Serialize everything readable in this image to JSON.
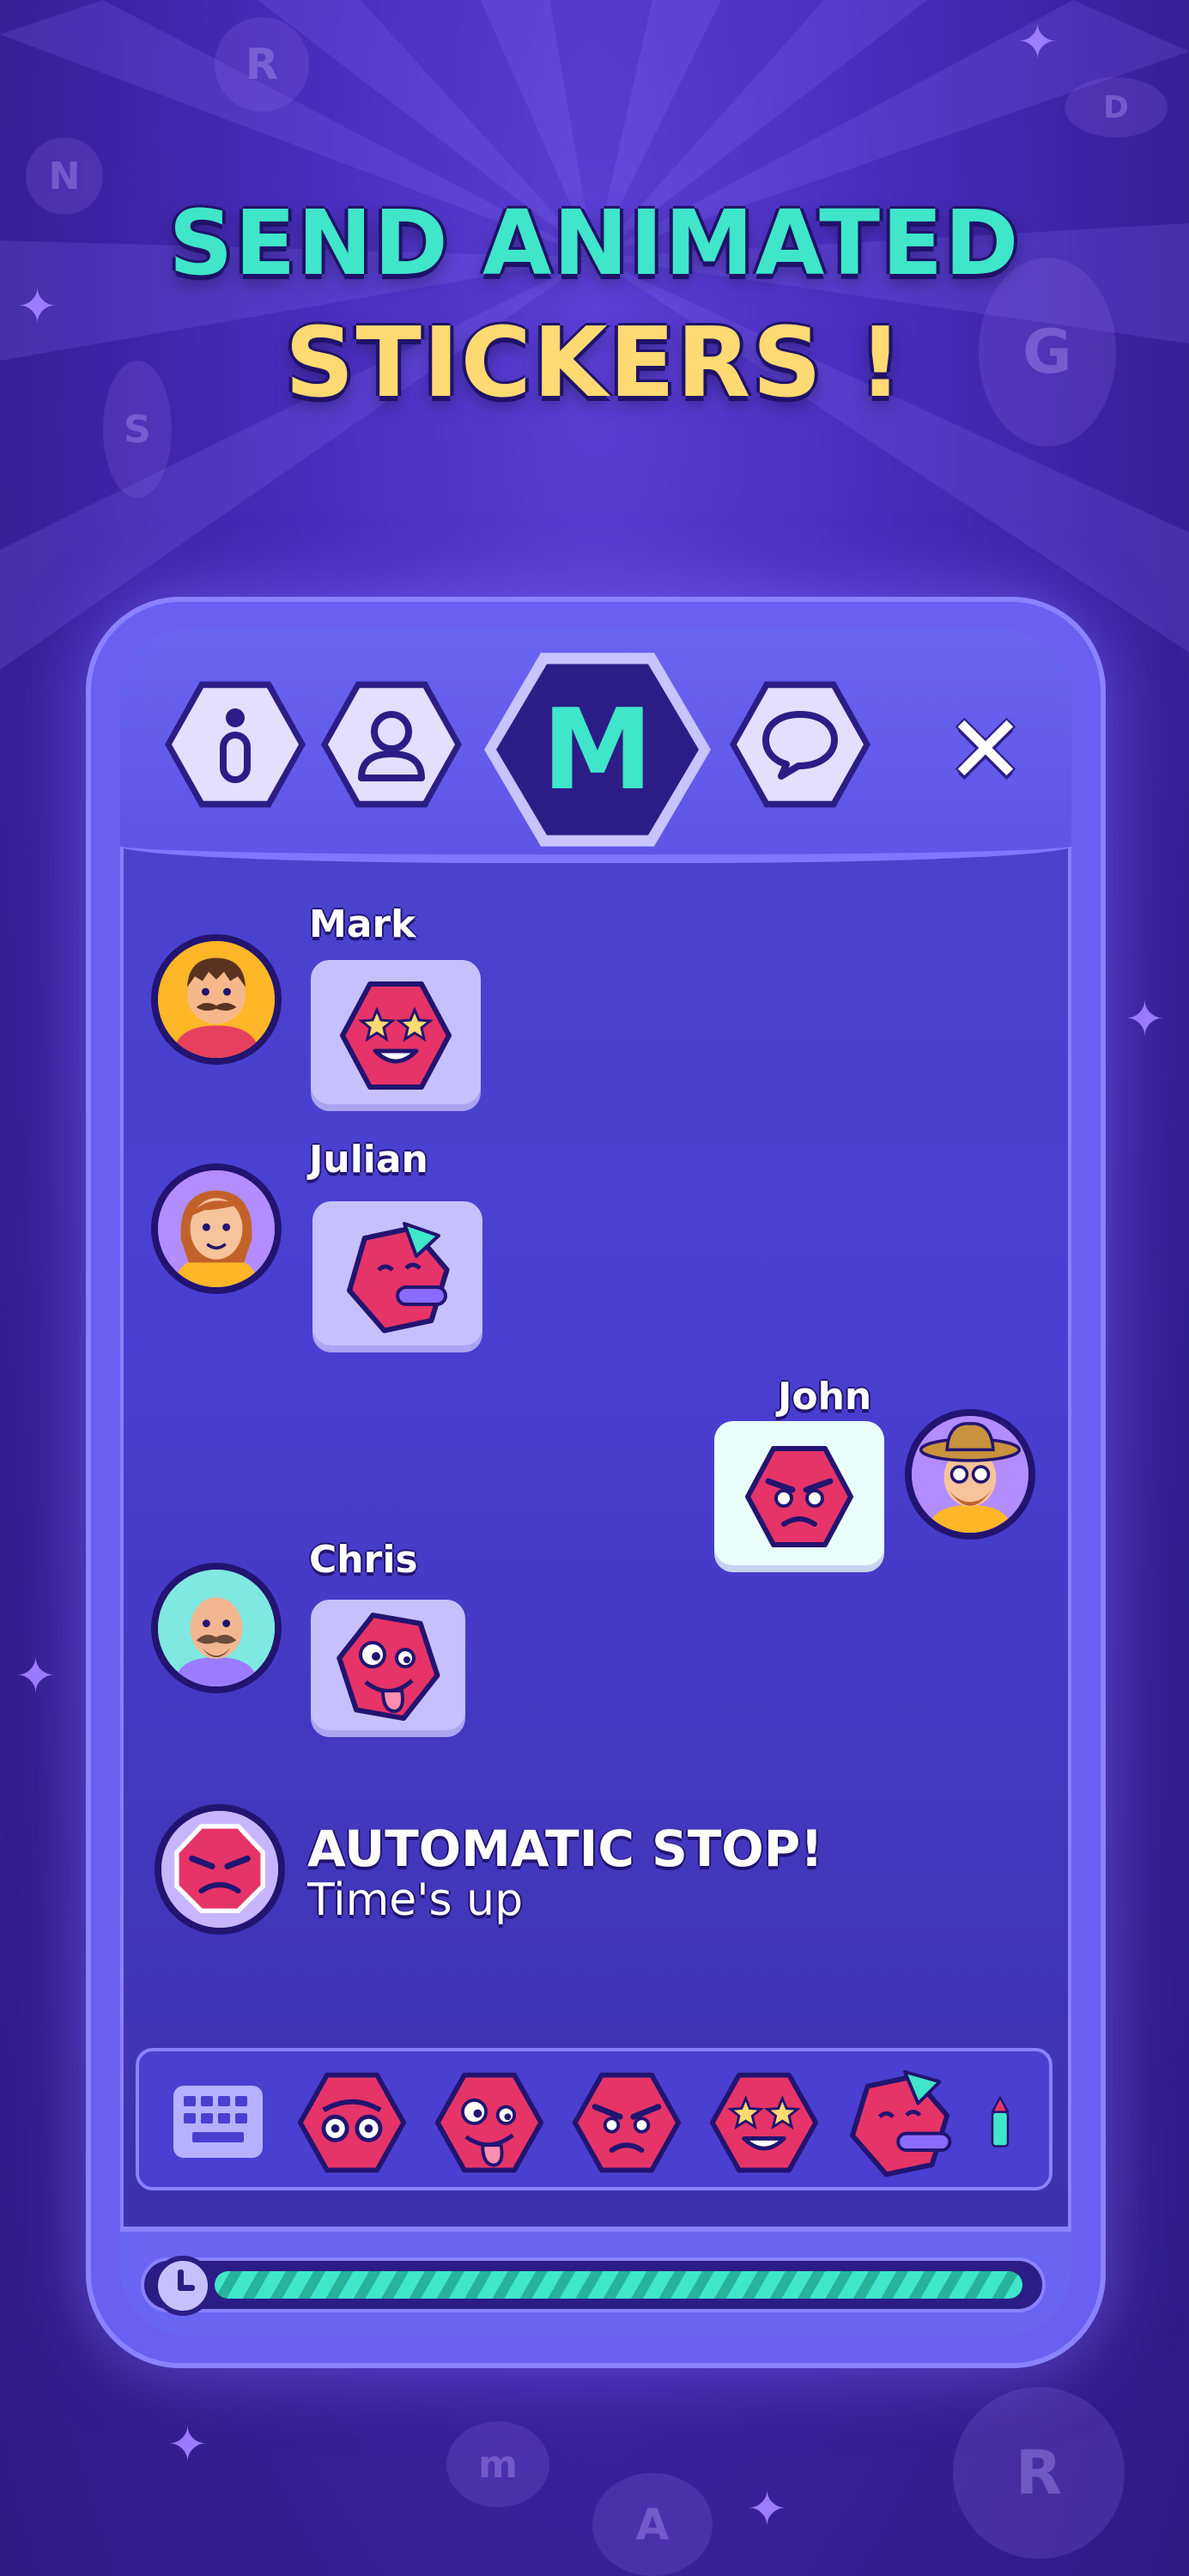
{
  "headline": {
    "line1": "SEND ANIMATED",
    "line2": "STICKERS !"
  },
  "tabs": [
    {
      "icon": "info-icon"
    },
    {
      "icon": "user-icon"
    },
    {
      "icon": "m-letter-icon",
      "label": "M",
      "active": true
    },
    {
      "icon": "chat-icon"
    }
  ],
  "close_icon": "close-icon",
  "messages": [
    {
      "sender": "Mark",
      "sticker": "star-eyes-sticker"
    },
    {
      "sender": "Julian",
      "sticker": "party-blower-sticker"
    },
    {
      "sender": "John",
      "sticker": "angry-sticker",
      "own": true
    },
    {
      "sender": "Chris",
      "sticker": "tongue-out-sticker"
    }
  ],
  "system_message": {
    "title": "AUTOMATIC STOP!",
    "subtitle": "Time's up",
    "icon": "stop-sign-icon"
  },
  "sticker_tray": {
    "keyboard_icon": "keyboard-icon",
    "stickers": [
      "round-eyes-sticker",
      "tongue-out-sticker",
      "angry-sticker",
      "star-eyes-sticker",
      "party-blower-sticker",
      "firework-sticker"
    ]
  },
  "timer": {
    "icon": "clock-icon",
    "progress": 0.99
  },
  "colors": {
    "accent_teal": "#3fe6c9",
    "accent_yellow": "#ffd972",
    "sticker_red": "#e63468",
    "frame": "#6a5ff0",
    "dark": "#221470"
  }
}
